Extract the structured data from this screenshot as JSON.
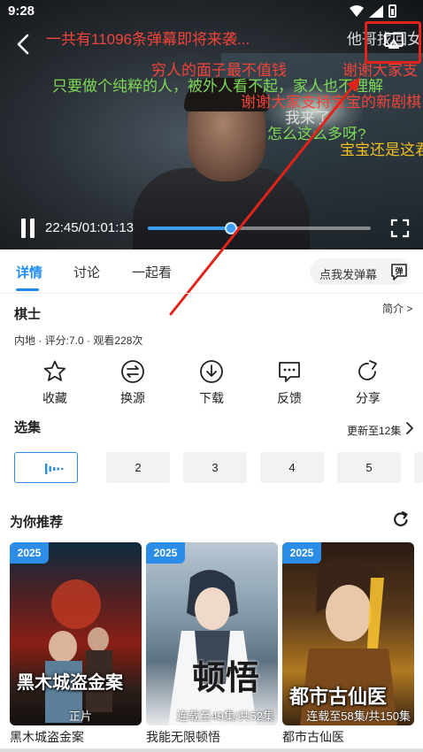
{
  "status_bar": {
    "time": "9:28"
  },
  "video": {
    "danmaku": [
      {
        "text": "一共有11096条弹幕即将来袭...",
        "color": "#f2443a"
      },
      {
        "text": "他哥找回女",
        "color": "#dddddd"
      },
      {
        "text": "穷人的面子最不值钱",
        "color": "#f2443a"
      },
      {
        "text": "谢谢大家支",
        "color": "#f2443a"
      },
      {
        "text": "只要做个纯粹的人，被外人看不起，家人也不理解",
        "color": "#7ed957"
      },
      {
        "text": "谢谢大家支持宝宝的新剧棋",
        "color": "#f2443a"
      },
      {
        "text": "我来了",
        "color": "#dddddd"
      },
      {
        "text": "怎么这么多呀?",
        "color": "#7ed957"
      },
      {
        "text": "宝宝还是这君",
        "color": "#f0c020"
      }
    ],
    "time_display": "22:45/01:01:13",
    "progress": 0.372,
    "accent_color": "#3b9cf0",
    "highlight_color": "#e2231a"
  },
  "tabs": [
    {
      "label": "详情",
      "active": true
    },
    {
      "label": "讨论",
      "active": false
    },
    {
      "label": "一起看",
      "active": false
    }
  ],
  "danmaku_button": {
    "label": "点我发弹幕",
    "icon_glyph": "弹"
  },
  "show": {
    "title": "棋士",
    "intro_label": "简介 >",
    "meta": "内地 · 评分:7.0 · 观看228次"
  },
  "actions": [
    {
      "label": "收藏",
      "icon": "star-icon"
    },
    {
      "label": "换源",
      "icon": "swap-icon"
    },
    {
      "label": "下载",
      "icon": "download-icon"
    },
    {
      "label": "反馈",
      "icon": "feedback-icon"
    },
    {
      "label": "分享",
      "icon": "share-icon"
    }
  ],
  "episodes": {
    "title": "选集",
    "update_text": "更新至12集",
    "items": [
      "",
      "2",
      "3",
      "4",
      "5"
    ]
  },
  "recommend": {
    "title": "为你推荐",
    "items": [
      {
        "year": "2025",
        "status": "正片",
        "name": "黑木城盗金案",
        "poster_text": "黑木城盗金案"
      },
      {
        "year": "2025",
        "status": "连载至49集/共52集",
        "name": "我能无限顿悟",
        "poster_text": "顿悟"
      },
      {
        "year": "2025",
        "status": "连载至58集/共150集",
        "name": "都市古仙医",
        "poster_text": "都市古仙医"
      }
    ]
  }
}
